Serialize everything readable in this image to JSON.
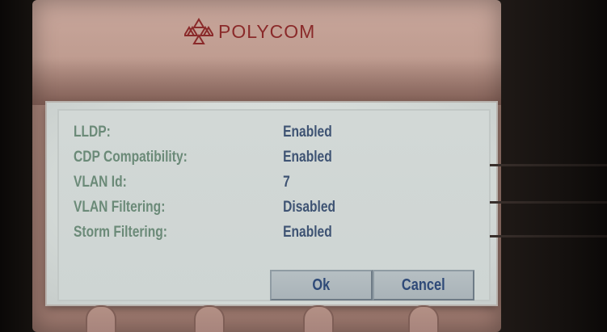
{
  "device": {
    "brand": "POLYCOM",
    "brand_icon": "polycom-triangle-logo",
    "brand_color": "#8a2a2a"
  },
  "screen": {
    "rows": [
      {
        "label": "LLDP:",
        "value": "Enabled"
      },
      {
        "label": "CDP Compatibility:",
        "value": "Enabled"
      },
      {
        "label": "VLAN Id:",
        "value": "7"
      },
      {
        "label": "VLAN Filtering:",
        "value": "Disabled"
      },
      {
        "label": "Storm Filtering:",
        "value": "Enabled"
      }
    ],
    "buttons": {
      "ok_label": "Ok",
      "cancel_label": "Cancel"
    },
    "label_color": "#6b8a78",
    "value_color": "#3e5373",
    "button_text_color": "#2f4a78"
  }
}
